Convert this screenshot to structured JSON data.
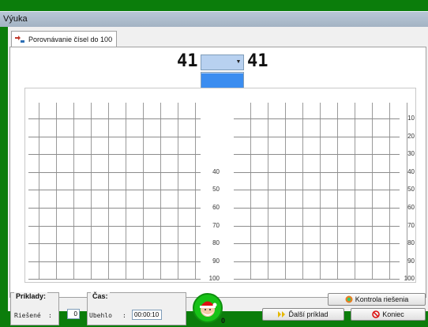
{
  "window": {
    "title": "Výuka"
  },
  "tab": {
    "label": "Porovnávanie čísel do 100"
  },
  "comparison": {
    "left_number": "41",
    "right_number": "41",
    "selected": "",
    "options": [
      "",
      "<",
      "=",
      ">"
    ]
  },
  "grid": {
    "row_labels": [
      "10",
      "20",
      "30",
      "40",
      "50",
      "60",
      "70",
      "80",
      "90",
      "100"
    ]
  },
  "stats": {
    "priklady_label": "Príklady:",
    "cas_label": "Čas:",
    "riesene_label": "Riešené",
    "riesene_sep": ":",
    "riesene_value": "0",
    "ubehlo_label": "Ubehlo",
    "ubehlo_sep": ":",
    "ubehlo_value": "00:00:10"
  },
  "buttons": {
    "kontrola": "Kontrola riešenia",
    "dalsi": "Ďalší príklad",
    "koniec": "Koniec"
  },
  "mascot": {
    "count": "0"
  },
  "colors": {
    "desktop": "#0b7d0b",
    "selection": "#b8d1f0",
    "highlight": "#3b8df0"
  }
}
